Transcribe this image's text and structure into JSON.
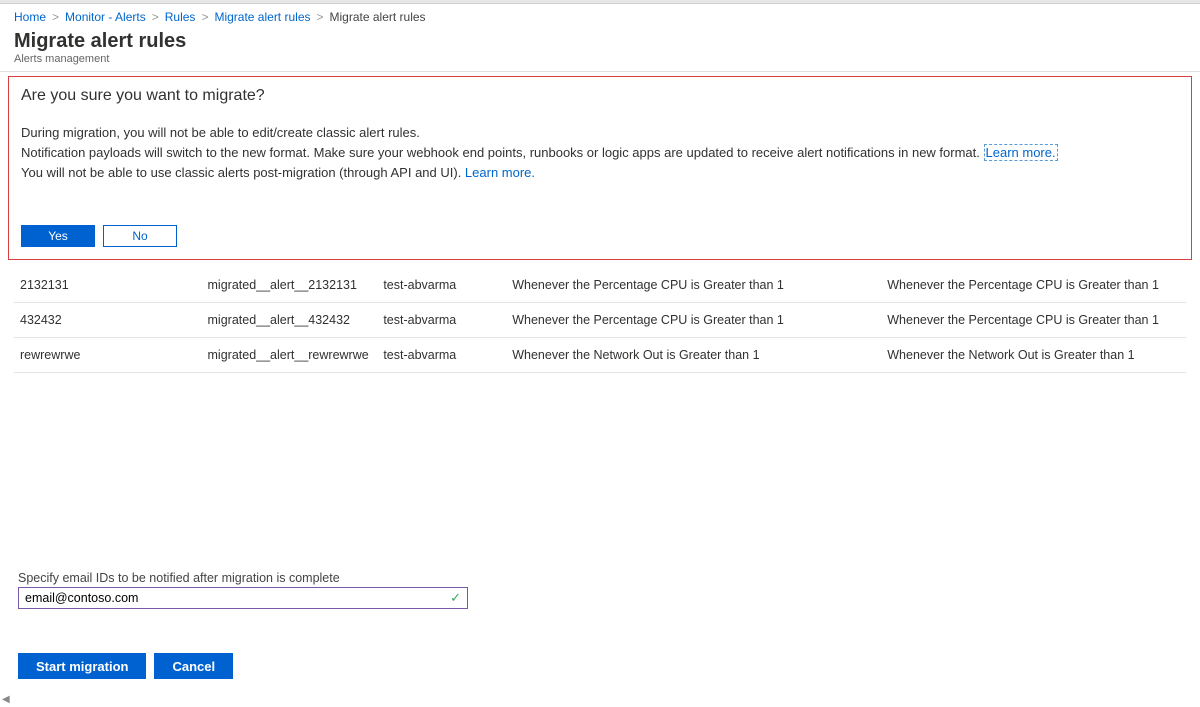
{
  "breadcrumb": {
    "items": [
      {
        "label": "Home",
        "link": true
      },
      {
        "label": "Monitor - Alerts",
        "link": true
      },
      {
        "label": "Rules",
        "link": true
      },
      {
        "label": "Migrate alert rules",
        "link": true
      },
      {
        "label": "Migrate alert rules",
        "link": false
      }
    ]
  },
  "header": {
    "title": "Migrate alert rules",
    "subtitle": "Alerts management"
  },
  "confirm": {
    "title": "Are you sure you want to migrate?",
    "line1": "During migration, you will not be able to edit/create classic alert rules.",
    "line2a": "Notification payloads will switch to the new format. Make sure your webhook end points, runbooks or logic apps are updated to receive alert notifications in new format. ",
    "learn1": "Learn more.",
    "line3a": "You will not be able to use classic alerts post-migration (through API and UI). ",
    "learn2": "Learn more.",
    "yes": "Yes",
    "no": "No"
  },
  "table": {
    "rows": [
      {
        "c1": "2132131",
        "c2": "migrated__alert__2132131",
        "c3": "test-abvarma",
        "c4": "Whenever the Percentage CPU is Greater than 1",
        "c5": "Whenever the Percentage CPU is Greater than 1"
      },
      {
        "c1": "432432",
        "c2": "migrated__alert__432432",
        "c3": "test-abvarma",
        "c4": "Whenever the Percentage CPU is Greater than 1",
        "c5": "Whenever the Percentage CPU is Greater than 1"
      },
      {
        "c1": "rewrewrwe",
        "c2": "migrated__alert__rewrewrwe",
        "c3": "test-abvarma",
        "c4": "Whenever the Network Out is Greater than 1",
        "c5": "Whenever the Network Out is Greater than 1"
      }
    ]
  },
  "email": {
    "label": "Specify email IDs to be notified after migration is complete",
    "value": "email@contoso.com"
  },
  "footer": {
    "start": "Start migration",
    "cancel": "Cancel"
  }
}
